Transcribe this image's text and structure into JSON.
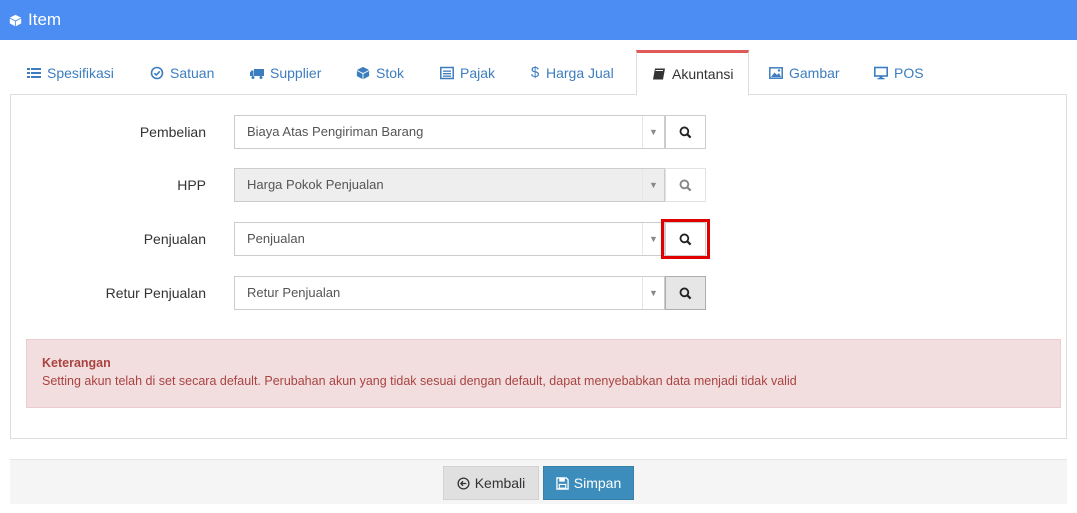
{
  "window": {
    "title": "Item",
    "icon": "cube-icon"
  },
  "tabs": [
    {
      "label": "Spesifikasi",
      "icon": "list-icon"
    },
    {
      "label": "Satuan",
      "icon": "check-circle-icon"
    },
    {
      "label": "Supplier",
      "icon": "truck-icon"
    },
    {
      "label": "Stok",
      "icon": "cube-icon"
    },
    {
      "label": "Pajak",
      "icon": "list-alt-icon"
    },
    {
      "label": "Harga Jual",
      "icon": "dollar-icon"
    },
    {
      "label": "Akuntansi",
      "icon": "book-icon",
      "active": true
    },
    {
      "label": "Gambar",
      "icon": "image-icon"
    },
    {
      "label": "POS",
      "icon": "monitor-icon"
    }
  ],
  "form": {
    "pembelian": {
      "label": "Pembelian",
      "value": "Biaya Atas Pengiriman Barang"
    },
    "hpp": {
      "label": "HPP",
      "value": "Harga Pokok Penjualan",
      "disabled": true
    },
    "penjualan": {
      "label": "Penjualan",
      "value": "Penjualan",
      "highlighted": true
    },
    "retur": {
      "label": "Retur Penjualan",
      "value": "Retur Penjualan"
    }
  },
  "alert": {
    "title": "Keterangan",
    "message": "Setting akun telah di set secara default. Perubahan akun yang tidak sesuai dengan default, dapat menyebabkan data menjadi tidak valid"
  },
  "footer": {
    "back_label": "Kembali",
    "save_label": "Simpan"
  },
  "colors": {
    "header": "#4b8df2",
    "link": "#3c7dbf",
    "active_tab_top": "#e05a5a",
    "highlight": "#e00000",
    "save": "#3c8dbc",
    "alert_bg": "#f2dede",
    "alert_text": "#a94442"
  }
}
